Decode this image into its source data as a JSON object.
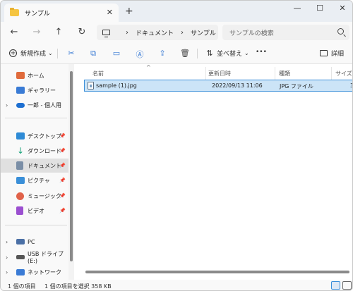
{
  "window": {
    "tab_title": "サンプル",
    "tab_close": "✕",
    "new_tab": "+",
    "minimize": "—",
    "maximize": "☐",
    "close": "✕"
  },
  "address": {
    "back": "←",
    "forward": "→",
    "up": "↑",
    "refresh": "↻",
    "separator": "›",
    "breadcrumb": [
      "ドキュメント",
      "サンプル"
    ],
    "search_placeholder": "サンプルの検索"
  },
  "toolbar": {
    "new_label": "新規作成",
    "new_chevron": "⌄",
    "sort_label": "並べ替え",
    "sort_chevron": "⌄",
    "more": "•••",
    "details_label": "詳細"
  },
  "sidebar": {
    "items": [
      {
        "label": "ホーム",
        "icon": "home-icon",
        "color": "#e06b3c"
      },
      {
        "label": "ギャラリー",
        "icon": "gallery-icon",
        "color": "#3a7bd5"
      },
      {
        "label": "一郎 - 個人用",
        "icon": "cloud-icon",
        "color": "#1d6fd1"
      },
      {
        "label": "デスクトップ",
        "icon": "desktop-icon",
        "color": "#2e8bd6"
      },
      {
        "label": "ダウンロード",
        "icon": "download-icon",
        "color": "#1aa37a"
      },
      {
        "label": "ドキュメント",
        "icon": "documents-icon",
        "color": "#7a8ea6"
      },
      {
        "label": "ピクチャ",
        "icon": "pictures-icon",
        "color": "#3a8fd8"
      },
      {
        "label": "ミュージック",
        "icon": "music-icon",
        "color": "#e0624a"
      },
      {
        "label": "ビデオ",
        "icon": "videos-icon",
        "color": "#9b4fd0"
      },
      {
        "label": "PC",
        "icon": "pc-icon",
        "color": "#4a6fa5"
      },
      {
        "label": "USB ドライブ (E:)",
        "icon": "usb-drive-icon",
        "color": "#555555"
      },
      {
        "label": "ネットワーク",
        "icon": "network-icon",
        "color": "#3a7bd5"
      }
    ],
    "expander": "›",
    "pin": "📌"
  },
  "columns": {
    "name": "名前",
    "date": "更新日時",
    "type": "種類",
    "size": "サイズ",
    "sort_indicator": "^"
  },
  "files": [
    {
      "name": "sample (1).jpg",
      "date": "2022/09/13 11:06",
      "type": "JPG ファイル",
      "size": "3"
    }
  ],
  "status": {
    "item_count": "1 個の項目",
    "selection": "1 個の項目を選択  358 KB"
  }
}
